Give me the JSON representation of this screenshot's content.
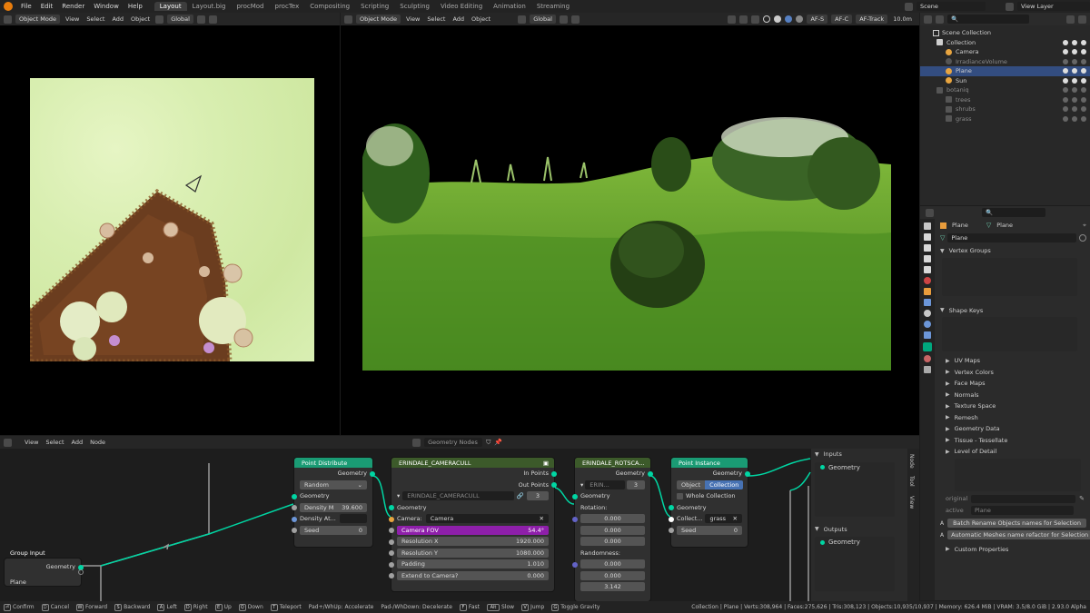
{
  "topbar": {
    "menus": [
      "File",
      "Edit",
      "Render",
      "Window",
      "Help"
    ],
    "workspaces": [
      "Layout",
      "Layout.big",
      "procMod",
      "procTex",
      "Compositing",
      "Scripting",
      "Sculpting",
      "Video Editing",
      "Animation",
      "Streaming"
    ],
    "active_workspace": "Layout",
    "scene": "Scene",
    "view_layer": "View Layer"
  },
  "left_viewport": {
    "mode": "Object Mode",
    "menus": [
      "View",
      "Select",
      "Add",
      "Object"
    ],
    "orientation": "Global"
  },
  "main_viewport": {
    "mode": "Object Mode",
    "menus": [
      "View",
      "Select",
      "Add",
      "Object"
    ],
    "orientation": "Global",
    "af_s": "AF-S",
    "af_c": "AF-C",
    "af_track": "AF-Track",
    "distance": "10.0m"
  },
  "outliner": {
    "root": "Scene Collection",
    "items": [
      {
        "label": "Collection",
        "indent": 1,
        "kind": "collection",
        "state": "normal"
      },
      {
        "label": "Camera",
        "indent": 2,
        "kind": "camera",
        "state": "normal"
      },
      {
        "label": "IrradianceVolume",
        "indent": 2,
        "kind": "probe",
        "state": "dim"
      },
      {
        "label": "Plane",
        "indent": 2,
        "kind": "mesh",
        "state": "selected"
      },
      {
        "label": "Sun",
        "indent": 2,
        "kind": "light",
        "state": "normal"
      },
      {
        "label": "botaniq",
        "indent": 1,
        "kind": "collection",
        "state": "dim"
      },
      {
        "label": "trees",
        "indent": 2,
        "kind": "collection",
        "state": "dim"
      },
      {
        "label": "shrubs",
        "indent": 2,
        "kind": "collection",
        "state": "dim"
      },
      {
        "label": "grass",
        "indent": 2,
        "kind": "collection",
        "state": "dim"
      }
    ]
  },
  "properties": {
    "object_name": "Plane",
    "data_name": "Plane",
    "mesh_field": "Plane",
    "vertex_groups": "Vertex Groups",
    "shape_keys": "Shape Keys",
    "panels": [
      "UV Maps",
      "Vertex Colors",
      "Face Maps",
      "Normals",
      "Texture Space",
      "Remesh",
      "Geometry Data",
      "Tissue - Tessellate",
      "Level of Detail"
    ],
    "original_label": "original",
    "active_label": "active",
    "active_value": "Plane",
    "btn_batch": "Batch Rename Objects names for Selection",
    "btn_auto": "Automatic Meshes name refactor for Selection",
    "custom_props": "Custom Properties"
  },
  "node_editor": {
    "menus": [
      "View",
      "Select",
      "Add",
      "Node"
    ],
    "tree_name": "Geometry Nodes",
    "group_input": {
      "title": "Group Input",
      "geometry": "Geometry",
      "object": "Plane"
    },
    "point_distribute": {
      "title": "Point Distribute",
      "out_geometry": "Geometry",
      "mode": "Random",
      "in_geometry": "Geometry",
      "density_max_label": "Density M",
      "density_max_value": "39.600",
      "density_attr_label": "Density At...",
      "seed_label": "Seed",
      "seed_value": "0"
    },
    "camera_cull": {
      "title": "ERINDALE_CAMERACULL",
      "in_points": "In Points",
      "out_points": "Out Points",
      "group_name": "ERINDALE_CAMERACULL",
      "users": "3",
      "geometry": "Geometry",
      "camera_label": "Camera:",
      "camera_value": "Camera",
      "fov_label": "Camera FOV",
      "fov_value": "54.4°",
      "res_x_label": "Resolution X",
      "res_x_value": "1920.000",
      "res_y_label": "Resolution Y",
      "res_y_value": "1080.000",
      "padding_label": "Padding",
      "padding_value": "1.010",
      "extend_label": "Extend to Camera?",
      "extend_value": "0.000"
    },
    "rotscale": {
      "title": "ERINDALE_ROTSCA...",
      "out_geometry": "Geometry",
      "group_name": "ERIN...",
      "users": "3",
      "in_geometry": "Geometry",
      "rotation_label": "Rotation:",
      "rotation": [
        "0.000",
        "0.000",
        "0.000"
      ],
      "randomness_label": "Randomness:",
      "randomness": [
        "0.000",
        "0.000",
        "3.142"
      ]
    },
    "point_instance": {
      "title": "Point Instance",
      "out_geometry": "Geometry",
      "tab_object": "Object",
      "tab_collection": "Collection",
      "whole_collection": "Whole Collection",
      "in_geometry": "Geometry",
      "collection_label": "Collect...",
      "collection_value": "grass",
      "seed_label": "Seed",
      "seed_value": "0"
    },
    "sidebar": {
      "inputs": "Inputs",
      "inputs_item": "Geometry",
      "outputs": "Outputs",
      "outputs_item": "Geometry",
      "tabs": [
        "Node",
        "Tool",
        "View"
      ]
    }
  },
  "statusbar": {
    "items": [
      {
        "key": "⏎",
        "label": "Confirm"
      },
      {
        "key": "⎋",
        "label": "Cancel"
      },
      {
        "key": "W",
        "label": "Forward"
      },
      {
        "key": "S",
        "label": "Backward"
      },
      {
        "key": "A",
        "label": "Left"
      },
      {
        "key": "D",
        "label": "Right"
      },
      {
        "key": "E",
        "label": "Up"
      },
      {
        "key": "Q",
        "label": "Down"
      },
      {
        "key": "T",
        "label": "Teleport"
      },
      {
        "key": "",
        "label": "Pad+/WhUp: Accelerate"
      },
      {
        "key": "",
        "label": "Pad-/WhDown: Decelerate"
      },
      {
        "key": "F",
        "label": "Fast"
      },
      {
        "key": "Alt",
        "label": "Slow"
      },
      {
        "key": "V",
        "label": "Jump"
      },
      {
        "key": "G",
        "label": "Toggle Gravity"
      }
    ],
    "stats": "Collection | Plane | Verts:308,964 | Faces:275,626 | Tris:308,123 | Objects:10,935/10,937 | Memory: 626.4 MiB | VRAM: 3.5/8.0 GiB | 2.93.0 Alpha"
  }
}
